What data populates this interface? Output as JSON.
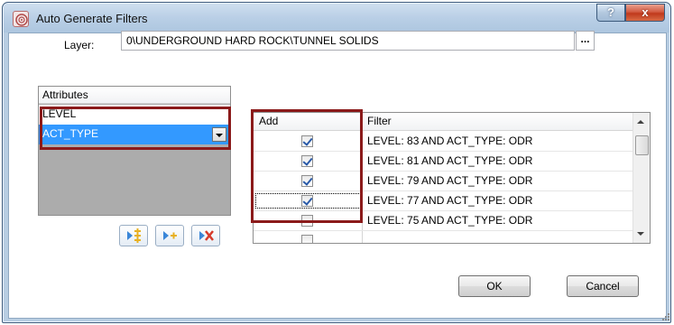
{
  "window": {
    "title": "Auto Generate Filters",
    "help_glyph": "?",
    "close_glyph": "x"
  },
  "layer": {
    "label": "Layer:",
    "value": "0\\UNDERGROUND HARD ROCK\\TUNNEL SOLIDS",
    "browse_label": "..."
  },
  "attributes": {
    "header": "Attributes",
    "items": [
      {
        "label": "LEVEL",
        "selected": false
      },
      {
        "label": "ACT_TYPE",
        "selected": true
      }
    ]
  },
  "grid": {
    "columns": [
      "Add",
      "Filter"
    ],
    "rows": [
      {
        "add": true,
        "filter": "LEVEL: 83 AND ACT_TYPE: ODR"
      },
      {
        "add": true,
        "filter": "LEVEL: 81 AND ACT_TYPE: ODR"
      },
      {
        "add": true,
        "filter": "LEVEL: 79 AND ACT_TYPE: ODR"
      },
      {
        "add": true,
        "filter": "LEVEL: 77 AND ACT_TYPE: ODR"
      },
      {
        "add": false,
        "filter": "LEVEL: 75 AND ACT_TYPE: ODR"
      },
      {
        "add": false,
        "filter": ""
      }
    ]
  },
  "buttons": {
    "ok": "OK",
    "cancel": "Cancel"
  },
  "icons": [
    "app-icon",
    "help-icon",
    "close-icon",
    "ellipsis-icon",
    "add-all-icon",
    "add-selected-icon",
    "remove-icon",
    "dropdown-arrow-icon",
    "scroll-up-icon",
    "scroll-down-icon",
    "resize-grip-icon"
  ],
  "colors": {
    "highlight": "#8b1a1a",
    "selection": "#3399ff",
    "checkmark": "#2a5aa8"
  }
}
